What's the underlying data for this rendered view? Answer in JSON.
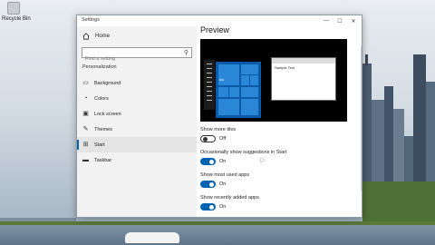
{
  "desktop": {
    "icon_label": "Recycle Bin"
  },
  "window": {
    "title": "Settings",
    "controls": {
      "minimize": "—",
      "maximize": "☐",
      "close": "✕"
    }
  },
  "nav": {
    "home_label": "Home",
    "search_placeholder": "Find a setting",
    "section_label": "Personalization",
    "items": [
      {
        "label": "Background",
        "icon": "picture-icon"
      },
      {
        "label": "Colors",
        "icon": "palette-icon"
      },
      {
        "label": "Lock screen",
        "icon": "lock-screen-icon"
      },
      {
        "label": "Themes",
        "icon": "brush-icon"
      },
      {
        "label": "Start",
        "icon": "start-icon",
        "active": true
      },
      {
        "label": "Taskbar",
        "icon": "taskbar-icon"
      }
    ]
  },
  "main": {
    "heading": "Preview",
    "preview": {
      "tile_label": "Aa",
      "sample_text": "Sample Text"
    },
    "toggles": [
      {
        "label": "Show more tiles",
        "state": "Off",
        "on": false
      },
      {
        "label": "Occasionally show suggestions in Start",
        "state": "On",
        "on": true
      },
      {
        "label": "Show most used apps",
        "state": "On",
        "on": true
      },
      {
        "label": "Show recently added apps",
        "state": "On",
        "on": true
      }
    ]
  },
  "colors": {
    "accent": "#0063b1",
    "nav_bg": "#f2f2f2"
  }
}
